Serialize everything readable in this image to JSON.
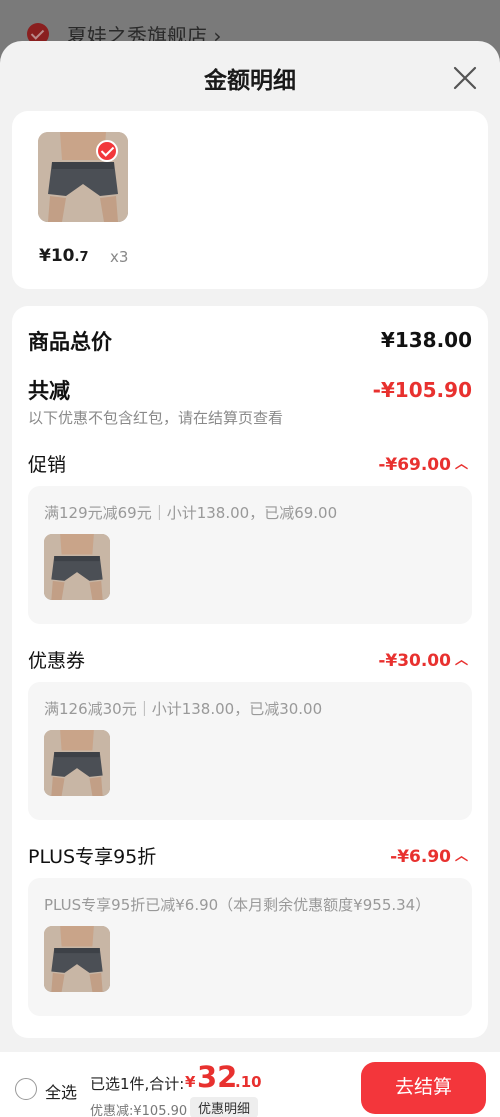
{
  "background": {
    "store_name": "夏娃之秀旗舰店 ›"
  },
  "sheet": {
    "title": "金额明细"
  },
  "product": {
    "price_main": "¥10",
    "price_decimal": ".7",
    "quantity": "x3"
  },
  "summary": {
    "total_label": "商品总价",
    "total_value": "¥138.00",
    "reduce_label": "共减",
    "reduce_value": "-¥105.90",
    "reduce_note": "以下优惠不包含红包，请在结算页查看"
  },
  "discounts": [
    {
      "label": "促销",
      "value": "-¥69.00",
      "detail": "满129元减69元｜小计138.00，已减69.00"
    },
    {
      "label": "优惠券",
      "value": "-¥30.00",
      "detail": "满126减30元｜小计138.00，已减30.00"
    },
    {
      "label": "PLUS专享95折",
      "value": "-¥6.90",
      "detail": "PLUS专享95折已减¥6.90（本月剩余优惠额度¥955.34）"
    }
  ],
  "bottom": {
    "select_all": "全选",
    "selected": "已选1件,合计:",
    "total_yen": "¥",
    "total_int": "32",
    "total_dec": ".10",
    "discount_note": "优惠减:¥105.90",
    "detail_tag": "优惠明细",
    "checkout": "去结算"
  },
  "colors": {
    "accent_red": "#e8312f",
    "button_red": "#f3363b",
    "sheet_bg": "#f2f2f2"
  },
  "icons": {
    "close": "close-icon",
    "chevron": "chevron-up-icon",
    "check": "check-icon"
  }
}
